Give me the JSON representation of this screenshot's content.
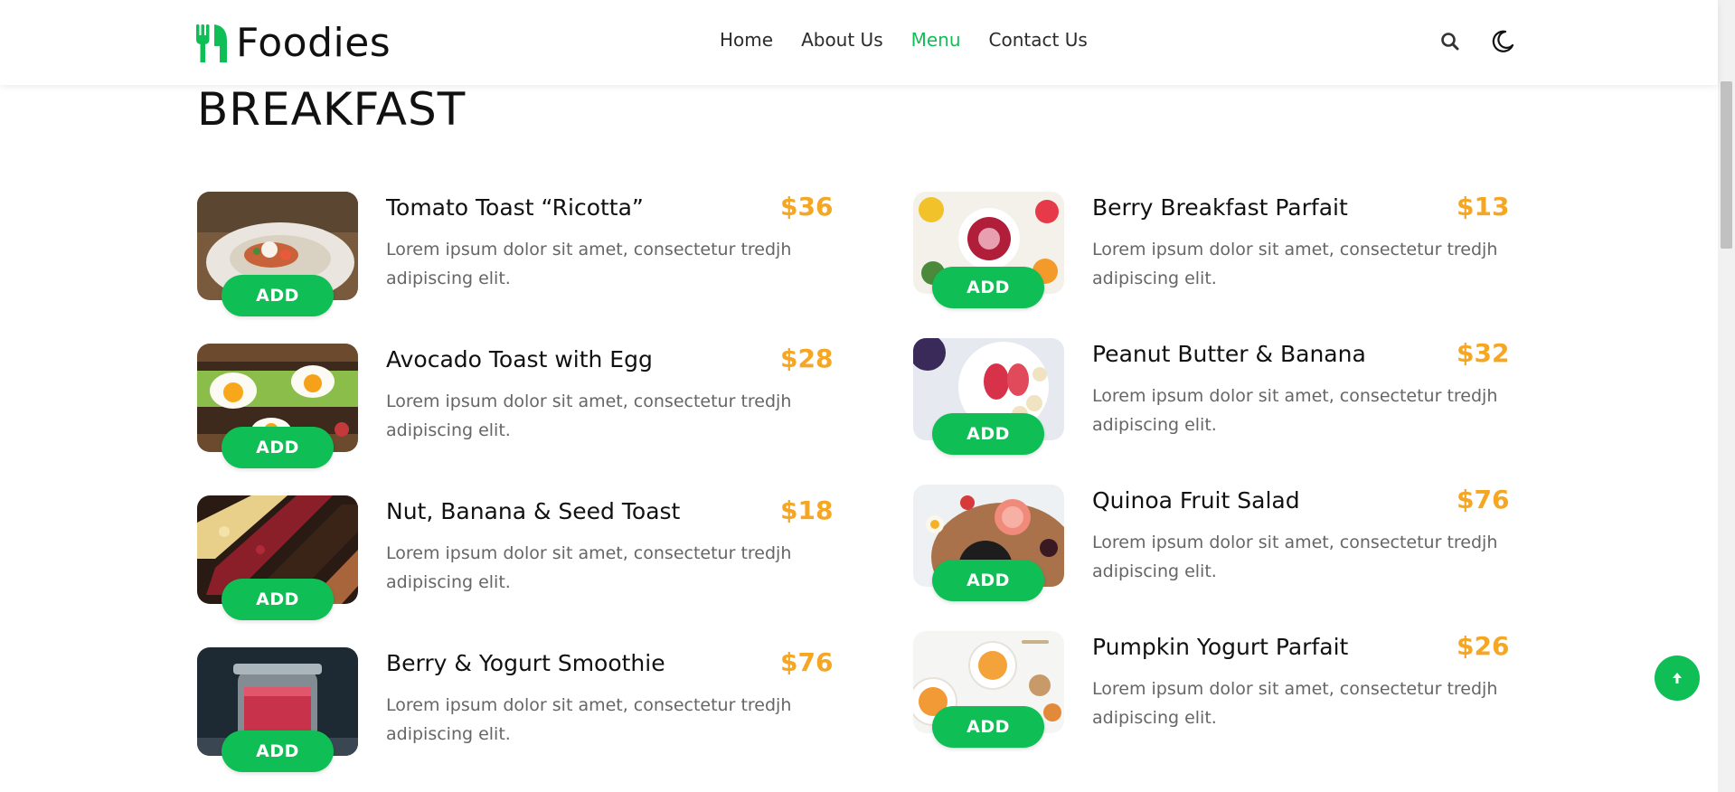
{
  "brand": {
    "name": "Foodies",
    "accent_color": "#10be56",
    "price_color": "#f5a623"
  },
  "nav": {
    "items": [
      {
        "label": "Home",
        "active": false
      },
      {
        "label": "About Us",
        "active": false
      },
      {
        "label": "Menu",
        "active": true
      },
      {
        "label": "Contact Us",
        "active": false
      }
    ]
  },
  "header_icons": {
    "search": "search-icon",
    "theme": "moon-icon"
  },
  "section": {
    "title": "BREAKFAST"
  },
  "menu": {
    "left": [
      {
        "name": "Tomato Toast “Ricotta”",
        "price": "$36",
        "desc": "Lorem ipsum dolor sit amet, consectetur tredjh adipiscing elit.",
        "button": "ADD"
      },
      {
        "name": "Avocado Toast with Egg",
        "price": "$28",
        "desc": "Lorem ipsum dolor sit amet, consectetur tredjh adipiscing elit.",
        "button": "ADD"
      },
      {
        "name": "Nut, Banana & Seed Toast",
        "price": "$18",
        "desc": "Lorem ipsum dolor sit amet, consectetur tredjh adipiscing elit.",
        "button": "ADD"
      },
      {
        "name": "Berry & Yogurt Smoothie",
        "price": "$76",
        "desc": "Lorem ipsum dolor sit amet, consectetur tredjh adipiscing elit.",
        "button": "ADD"
      }
    ],
    "right": [
      {
        "name": "Berry Breakfast Parfait",
        "price": "$13",
        "desc": "Lorem ipsum dolor sit amet, consectetur tredjh adipiscing elit.",
        "button": "ADD"
      },
      {
        "name": "Peanut Butter & Banana",
        "price": "$32",
        "desc": "Lorem ipsum dolor sit amet, consectetur tredjh adipiscing elit.",
        "button": "ADD"
      },
      {
        "name": "Quinoa Fruit Salad",
        "price": "$76",
        "desc": "Lorem ipsum dolor sit amet, consectetur tredjh adipiscing elit.",
        "button": "ADD"
      },
      {
        "name": "Pumpkin Yogurt Parfait",
        "price": "$26",
        "desc": "Lorem ipsum dolor sit amet, consectetur tredjh adipiscing elit.",
        "button": "ADD"
      }
    ]
  },
  "scroll_top_icon": "arrow-up-icon"
}
